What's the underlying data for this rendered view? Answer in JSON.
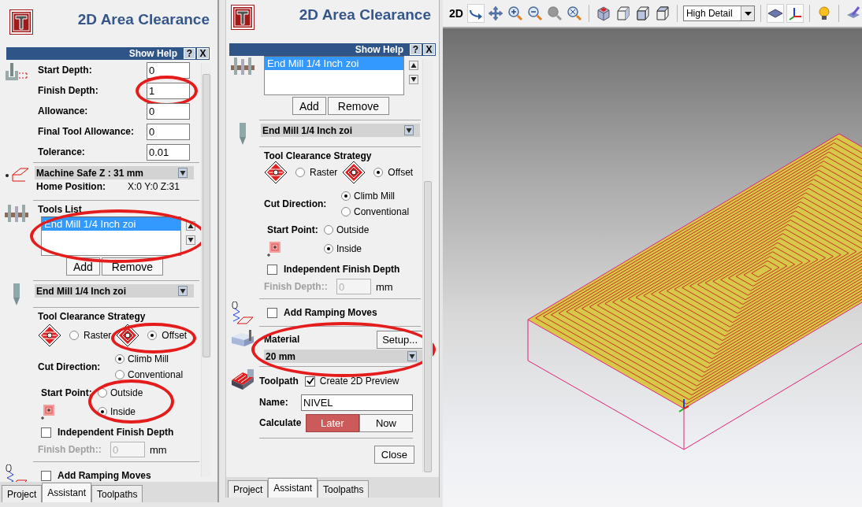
{
  "panels": [
    {
      "title": "2D Area Clearance",
      "help": {
        "label": "Show Help",
        "buttons": [
          "?",
          "X"
        ]
      },
      "sections": [
        {
          "kind": "depths",
          "fields": [
            {
              "label": "Start Depth:",
              "value": "0"
            },
            {
              "label": "Finish Depth:",
              "value": "1",
              "circled": true
            },
            {
              "label": "Allowance:",
              "value": "0"
            },
            {
              "label": "Final Tool Allowance:",
              "value": "0"
            },
            {
              "label": "Tolerance:",
              "value": "0.01"
            }
          ]
        },
        {
          "kind": "safez",
          "dropdown": "Machine Safe Z : 31 mm",
          "label": "Home Position:",
          "value": "X:0 Y:0 Z:31"
        },
        {
          "kind": "tools",
          "heading": "Tools List",
          "items": [
            {
              "label": "End Mill 1/4 Inch zoi",
              "selected": true
            }
          ],
          "circled": true,
          "buttons": [
            "Add",
            "Remove"
          ]
        },
        {
          "kind": "tool-select",
          "value": "End Mill 1/4 Inch zoi"
        },
        {
          "kind": "strategy",
          "heading": "Tool Clearance Strategy",
          "options": [
            {
              "label": "Raster",
              "selected": false
            },
            {
              "label": "Offset",
              "selected": true,
              "circled": true
            }
          ]
        },
        {
          "kind": "cutdir",
          "label": "Cut Direction:",
          "options": [
            {
              "label": "Climb Mill",
              "selected": true
            },
            {
              "label": "Conventional",
              "selected": false
            }
          ]
        },
        {
          "kind": "startpoint",
          "label": "Start Point:",
          "circled": true,
          "options": [
            {
              "label": "Outside",
              "selected": false
            },
            {
              "label": "Inside",
              "selected": true
            }
          ]
        },
        {
          "kind": "finish",
          "checkbox": {
            "label": "Independent Finish Depth",
            "checked": false
          },
          "label": "Finish Depth::",
          "value": "0",
          "unit": "mm"
        },
        {
          "kind": "ramping",
          "label": "Add Ramping Moves",
          "checked": false
        }
      ],
      "tabs": [
        {
          "label": "Project",
          "selected": false
        },
        {
          "label": "Assistant",
          "selected": true
        },
        {
          "label": "Toolpaths",
          "selected": false
        }
      ]
    },
    {
      "title": "2D Area Clearance",
      "help": {
        "label": "Show Help",
        "buttons": [
          "?",
          "X"
        ]
      },
      "sections": [
        {
          "kind": "tools",
          "items": [
            {
              "label": "End Mill 1/4 Inch zoi",
              "selected": true
            }
          ],
          "buttons": [
            "Add",
            "Remove"
          ]
        },
        {
          "kind": "tool-select",
          "value": "End Mill 1/4 Inch zoi"
        },
        {
          "kind": "strategy",
          "heading": "Tool Clearance Strategy",
          "options": [
            {
              "label": "Raster",
              "selected": false
            },
            {
              "label": "Offset",
              "selected": true
            }
          ]
        },
        {
          "kind": "cutdir",
          "label": "Cut Direction:",
          "options": [
            {
              "label": "Climb Mill",
              "selected": true
            },
            {
              "label": "Conventional",
              "selected": false
            }
          ]
        },
        {
          "kind": "startpoint",
          "label": "Start Point:",
          "options": [
            {
              "label": "Outside",
              "selected": false
            },
            {
              "label": "Inside",
              "selected": true
            }
          ]
        },
        {
          "kind": "finish",
          "checkbox": {
            "label": "Independent Finish Depth",
            "checked": false
          },
          "label": "Finish Depth::",
          "value": "0",
          "unit": "mm"
        },
        {
          "kind": "ramping",
          "label": "Add Ramping Moves",
          "checked": false
        },
        {
          "kind": "material",
          "label": "Material",
          "button": "Setup...",
          "value": "20 mm",
          "circled": true
        },
        {
          "kind": "toolpath",
          "label": "Toolpath",
          "checkbox": {
            "label": "Create 2D Preview",
            "checked": true
          },
          "name_label": "Name:",
          "name": "NIVEL",
          "calc_label": "Calculate",
          "buttons": [
            {
              "label": "Later",
              "selected": true
            },
            {
              "label": "Now",
              "selected": false
            }
          ]
        },
        {
          "kind": "close",
          "label": "Close"
        }
      ],
      "tabs": [
        {
          "label": "Project",
          "selected": false
        },
        {
          "label": "Assistant",
          "selected": true
        },
        {
          "label": "Toolpaths",
          "selected": false
        }
      ]
    }
  ],
  "toolbar": {
    "label": "2D",
    "groups": [
      [
        {
          "kind": "rotate",
          "pressed": true
        },
        {
          "kind": "pan",
          "pressed": false
        },
        {
          "kind": "zoom-in",
          "pressed": false
        },
        {
          "kind": "zoom-out",
          "pressed": false
        },
        {
          "kind": "zoom",
          "pressed": false
        },
        {
          "kind": "zoom-fit",
          "pressed": false
        }
      ],
      [
        {
          "kind": "iso",
          "pressed": false
        },
        {
          "kind": "wire-a",
          "pressed": false
        },
        {
          "kind": "wire-b",
          "pressed": false
        },
        {
          "kind": "wire-c",
          "pressed": false
        }
      ],
      [
        {
          "kind": "select",
          "value": "High Detail"
        }
      ],
      [
        {
          "kind": "shaded",
          "pressed": true
        },
        {
          "kind": "axes",
          "pressed": true
        }
      ],
      [
        {
          "kind": "bulb",
          "pressed": false
        }
      ],
      [
        {
          "kind": "brush",
          "pressed": false
        }
      ]
    ]
  }
}
